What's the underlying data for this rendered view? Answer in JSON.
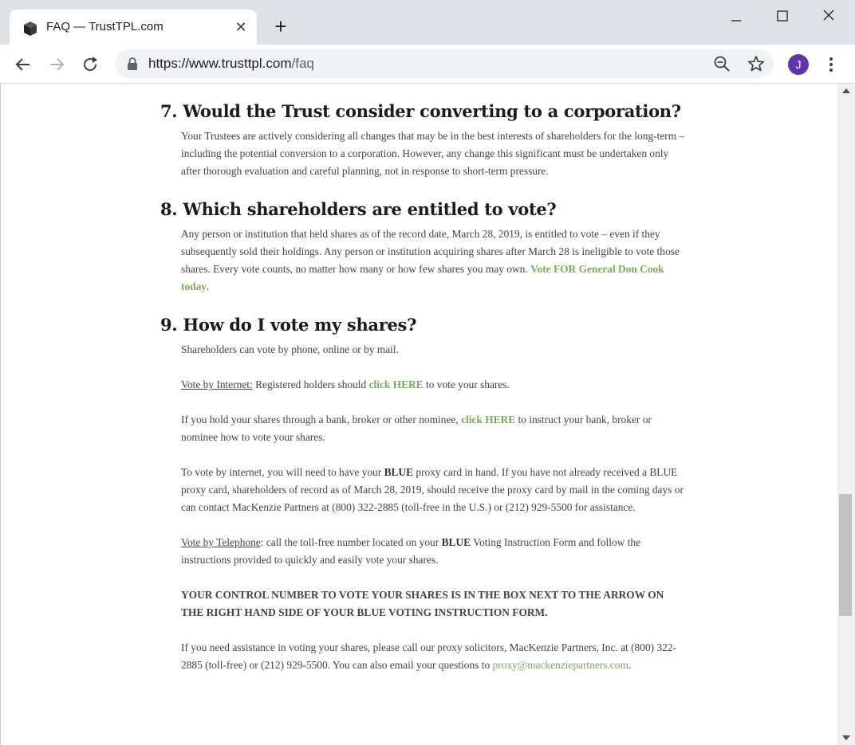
{
  "browser": {
    "tab_title": "FAQ — TrustTPL.com",
    "url_host": "https://www.trusttpl.com",
    "url_path": "/faq",
    "avatar_letter": "J",
    "avatar_color": "#5e35b1"
  },
  "faq": {
    "q7": {
      "title": "7. Would the Trust consider converting to a corporation?",
      "body": "Your Trustees are actively considering all changes that may be in the best interests of shareholders for the long-term – including the potential conversion to a corporation. However, any change this significant must be undertaken only after thorough evaluation and careful planning, not in response to short-term pressure."
    },
    "q8": {
      "title": "8. Which shareholders are entitled to vote?",
      "body": "Any person or institution that held shares as of the record date, March 28, 2019, is entitled to vote – even if they subsequently sold their holdings. Any person or institution acquiring shares after March 28 is ineligible to vote those shares. Every vote counts, no matter how many or how few shares you may own.",
      "link": "Vote FOR General Don Cook today"
    },
    "q9": {
      "title": "9. How do I vote my shares?",
      "intro": "Shareholders can vote by phone, online or by mail.",
      "internet_label": "Vote by Internet:",
      "internet_text_a": "Registered holders should",
      "internet_link": "click HERE",
      "internet_text_b": "to vote your shares.",
      "nominee_text_a": "If you hold your shares through a bank, broker or other nominee,",
      "nominee_link": "click HERE",
      "nominee_text_b": "to instruct your bank, broker or nominee how to vote your shares.",
      "card_text_a": "To vote by internet, you will need to have your",
      "card_blue_1": "BLUE",
      "card_text_b": "proxy card in hand. If you have not already received a BLUE proxy card, shareholders of record as of March 28, 2019, should receive the proxy card by mail in the coming days or can contact MacKenzie Partners at (800) 322-2885 (toll-free in the U.S.) or (212) 929-5500 for assistance.",
      "phone_label": "Vote by Telephone",
      "phone_text_a": ": call the toll-free number located on your",
      "phone_blue": "BLUE",
      "phone_text_b": "Voting Instruction Form and follow the instructions provided to quickly and easily vote your shares.",
      "control_notice": "YOUR CONTROL NUMBER TO VOTE YOUR SHARES IS IN THE BOX NEXT TO THE ARROW ON THE RIGHT HAND SIDE OF YOUR BLUE VOTING INSTRUCTION FORM.",
      "help_text": "If you need assistance in voting your shares, please call our proxy solicitors, MacKenzie Partners, Inc. at (800) 322-2885 (toll-free) or (212) 929-5500. You can also email your questions to",
      "help_email": "proxy@mackenziepartners.com",
      "help_end": "."
    }
  },
  "colors": {
    "link_green": "#7aaa5e",
    "heading": "#1b1b1b",
    "body_text": "#444444"
  }
}
